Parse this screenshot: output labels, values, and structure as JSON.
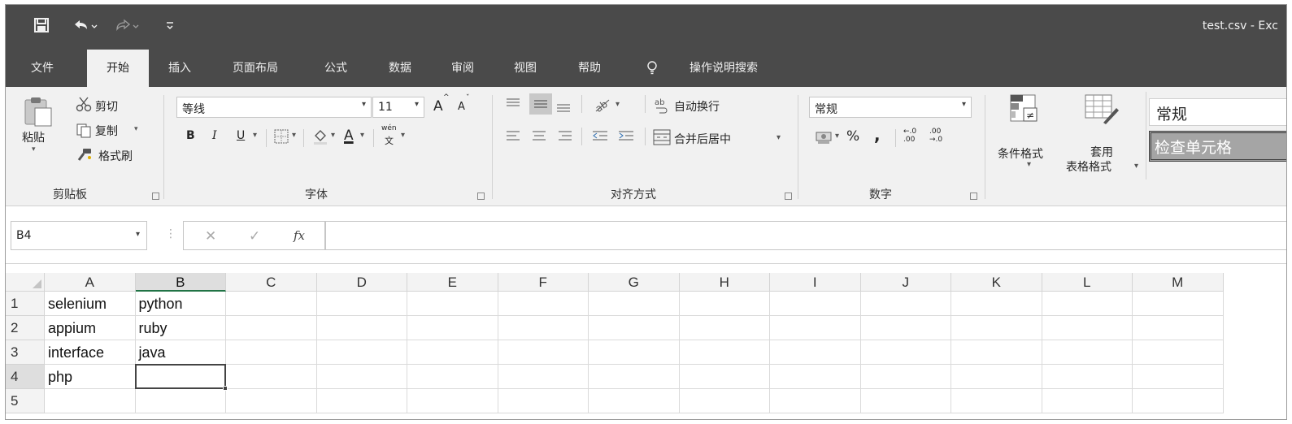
{
  "title_bar": {
    "document_title": "test.csv  -  Exc",
    "save_icon": "save-icon",
    "undo_icon": "undo-icon",
    "redo_icon": "redo-icon",
    "customize_icon": "customize-qat-icon"
  },
  "tabs": [
    {
      "label": "文件",
      "active": false
    },
    {
      "label": "开始",
      "active": true
    },
    {
      "label": "插入",
      "active": false
    },
    {
      "label": "页面布局",
      "active": false
    },
    {
      "label": "公式",
      "active": false
    },
    {
      "label": "数据",
      "active": false
    },
    {
      "label": "审阅",
      "active": false
    },
    {
      "label": "视图",
      "active": false
    },
    {
      "label": "帮助",
      "active": false
    }
  ],
  "tell_me": {
    "label": "操作说明搜索",
    "icon": "lightbulb-icon"
  },
  "ribbon": {
    "clipboard": {
      "group_label": "剪贴板",
      "paste_label": "粘贴",
      "cut_label": "剪切",
      "copy_label": "复制",
      "format_painter_label": "格式刷"
    },
    "font": {
      "group_label": "字体",
      "font_name": "等线",
      "font_size": "11",
      "grow_font": "A",
      "shrink_font": "A",
      "bold": "B",
      "italic": "I",
      "underline": "U",
      "font_color_letter": "A",
      "phonetic_top": "wén",
      "phonetic_bottom": "文"
    },
    "alignment": {
      "group_label": "对齐方式",
      "wrap_text_label": "自动换行",
      "merge_center_label": "合并后居中"
    },
    "number": {
      "group_label": "数字",
      "format_value": "常规",
      "percent": "%",
      "comma": ",",
      "increase_decimal": "←.0\n.00",
      "decrease_decimal": ".00\n→.0"
    },
    "styles": {
      "conditional_format_label": "条件格式",
      "format_as_table_line1": "套用",
      "format_as_table_line2": "表格格式",
      "style_normal": "常规",
      "style_check_cell": "检查单元格"
    }
  },
  "formula_bar": {
    "name_box": "B4",
    "cancel_symbol": "✕",
    "enter_symbol": "✓",
    "fx_label": "fx",
    "formula_value": ""
  },
  "sheet": {
    "columns": [
      "A",
      "B",
      "C",
      "D",
      "E",
      "F",
      "G",
      "H",
      "I",
      "J",
      "K",
      "L",
      "M"
    ],
    "selected_column": "B",
    "row_numbers": [
      "1",
      "2",
      "3",
      "4",
      "5"
    ],
    "selected_row": "4",
    "rows": [
      [
        "selenium",
        "python"
      ],
      [
        "appium",
        "ruby"
      ],
      [
        "interface",
        "java"
      ],
      [
        "php",
        ""
      ],
      [
        "",
        ""
      ]
    ],
    "active_cell": "B4"
  },
  "colors": {
    "title_bar_bg": "#4a4a4a",
    "ribbon_bg": "#f1f1f1",
    "selection_border": "#444444",
    "header_selected_bg": "#dedede"
  }
}
